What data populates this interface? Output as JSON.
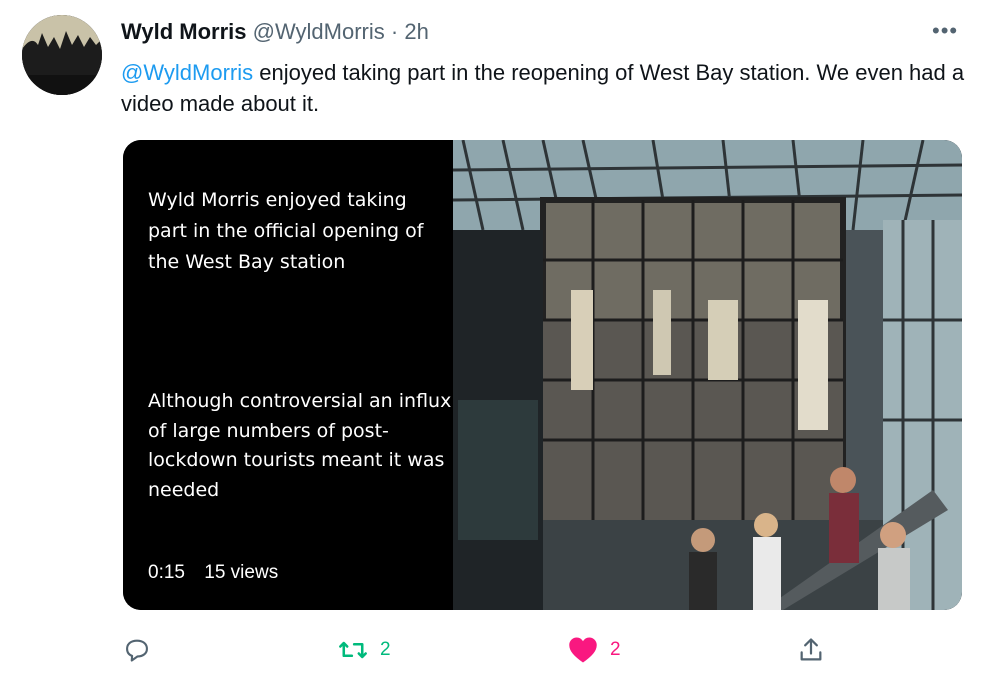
{
  "tweet": {
    "author_name": "Wyld Morris",
    "author_handle": "@WyldMorris",
    "separator": "·",
    "timestamp": "2h",
    "more_icon": "more-icon",
    "text_mention": "@WyldMorris",
    "text_body": " enjoyed taking part in the reopening of West Bay station.  We even had a video made about it."
  },
  "video": {
    "caption_1": "Wyld Morris enjoyed taking part in the official opening of the West Bay station",
    "caption_2": "Although controversial an influx of large numbers of post-lockdown tourists meant it was needed",
    "duration": "0:15",
    "views": "15 views"
  },
  "actions": {
    "reply_count": "",
    "retweet_count": "2",
    "like_count": "2",
    "colors": {
      "retweet": "#00ba7c",
      "like": "#f91880",
      "link": "#1d9bf0"
    }
  }
}
